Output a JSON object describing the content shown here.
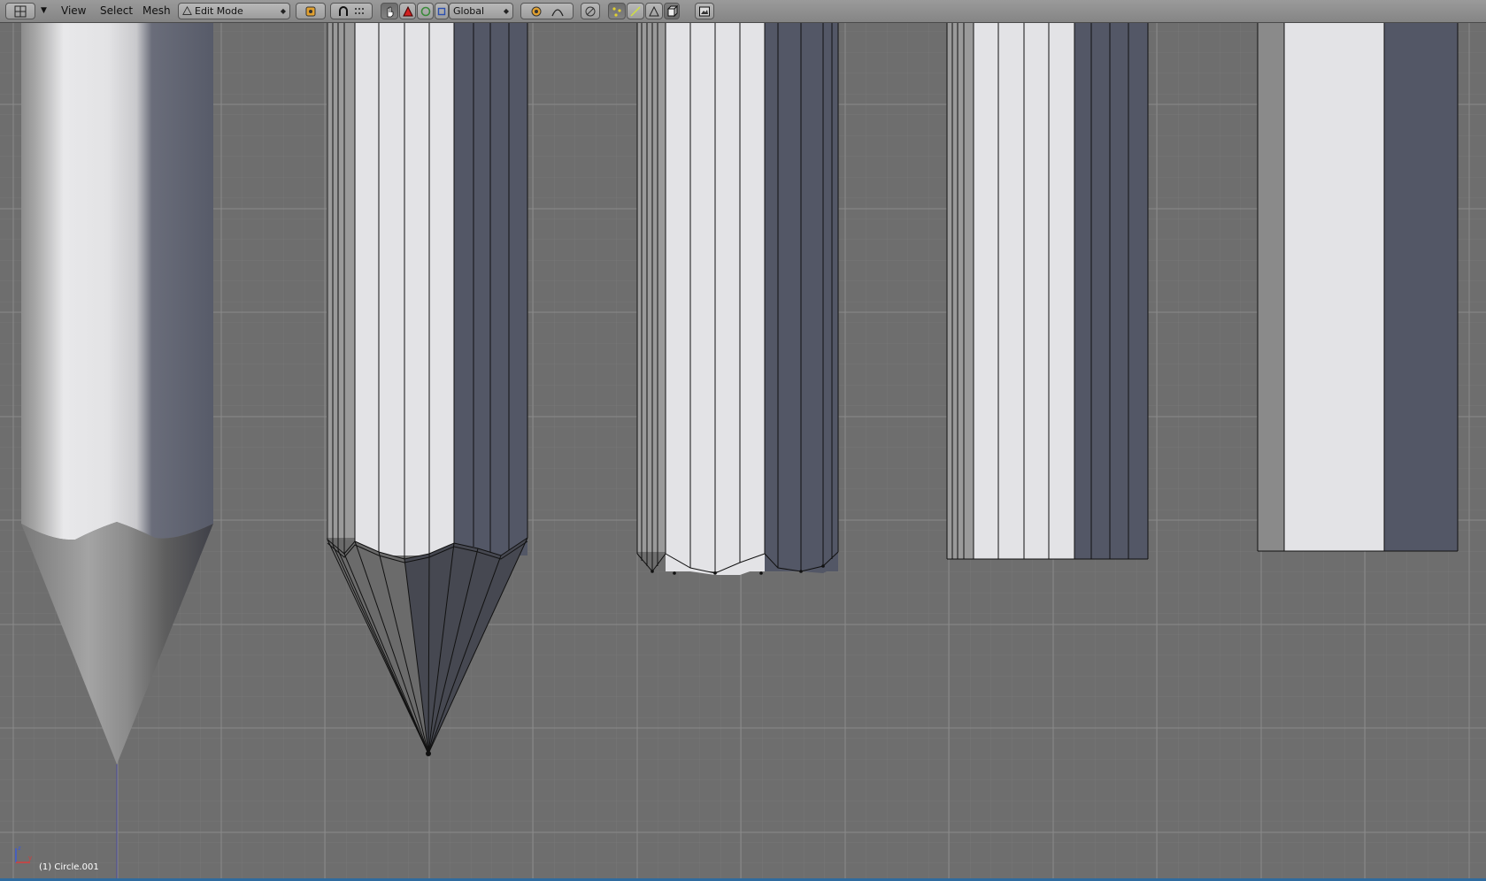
{
  "toolbar": {
    "menus": [
      "View",
      "Select",
      "Mesh"
    ],
    "mode_dropdown": "Edit Mode",
    "orientation_dropdown": "Global"
  },
  "status": {
    "object_info": "(1) Circle.001"
  },
  "axis_labels": {
    "z": "z",
    "y": "y"
  },
  "colors": {
    "viewport_bg": "#6e6e6e",
    "grid_minor": "#777777",
    "grid_major": "#8a8a8a",
    "face_light": "#e3e3e6",
    "face_dark": "#535766",
    "face_mid": "#8a8a8a",
    "edge": "#111111"
  }
}
